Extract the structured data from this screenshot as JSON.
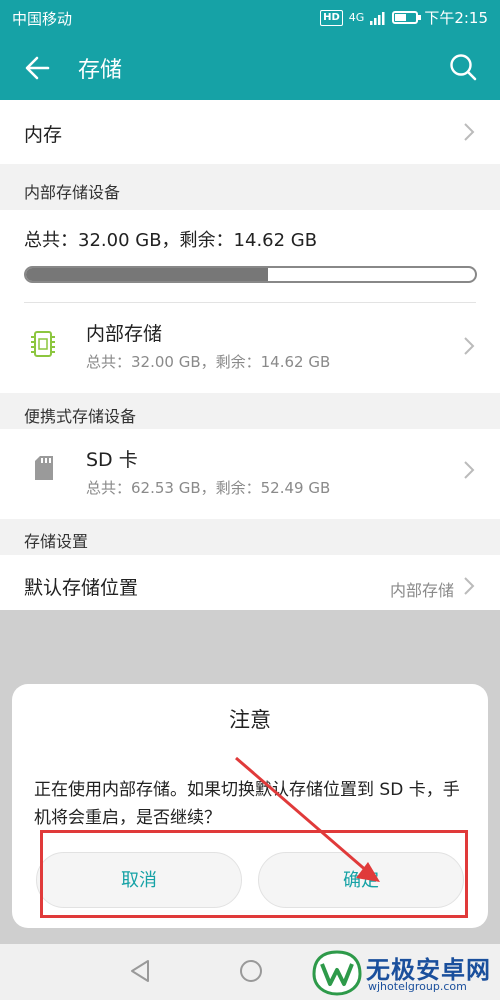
{
  "status_bar": {
    "carrier": "中国移动",
    "hd": "HD",
    "signal": "4G",
    "time": "下午2:15",
    "battery_level": 0.5
  },
  "app_bar": {
    "title": "存储",
    "back_icon": "back-arrow-icon",
    "search_icon": "search-icon"
  },
  "memory_row": {
    "label": "内存"
  },
  "internal_section": {
    "header": "内部存储设备",
    "summary": "总共：32.00 GB，剩余：14.62 GB",
    "used_fraction": 0.54,
    "item": {
      "title": "内部存储",
      "detail": "总共：32.00 GB，剩余：14.62 GB",
      "icon": "chip-icon"
    }
  },
  "portable_section": {
    "header": "便携式存储设备",
    "item": {
      "title": "SD 卡",
      "detail": "总共：62.53 GB，剩余：52.49 GB",
      "icon": "sd-card-icon"
    }
  },
  "settings_section": {
    "header": "存储设置",
    "default_location": {
      "label": "默认存储位置",
      "value": "内部存储"
    }
  },
  "dialog": {
    "title": "注意",
    "message": "正在使用内部存储。如果切换默认存储位置到 SD 卡，手机将会重启，是否继续？",
    "cancel_label": "取消",
    "confirm_label": "确定"
  },
  "watermark": {
    "title": "无极安卓网",
    "url": "wjhotelgroup.com"
  },
  "colors": {
    "accent": "#16a2a6",
    "annotation": "#e03a3a"
  }
}
